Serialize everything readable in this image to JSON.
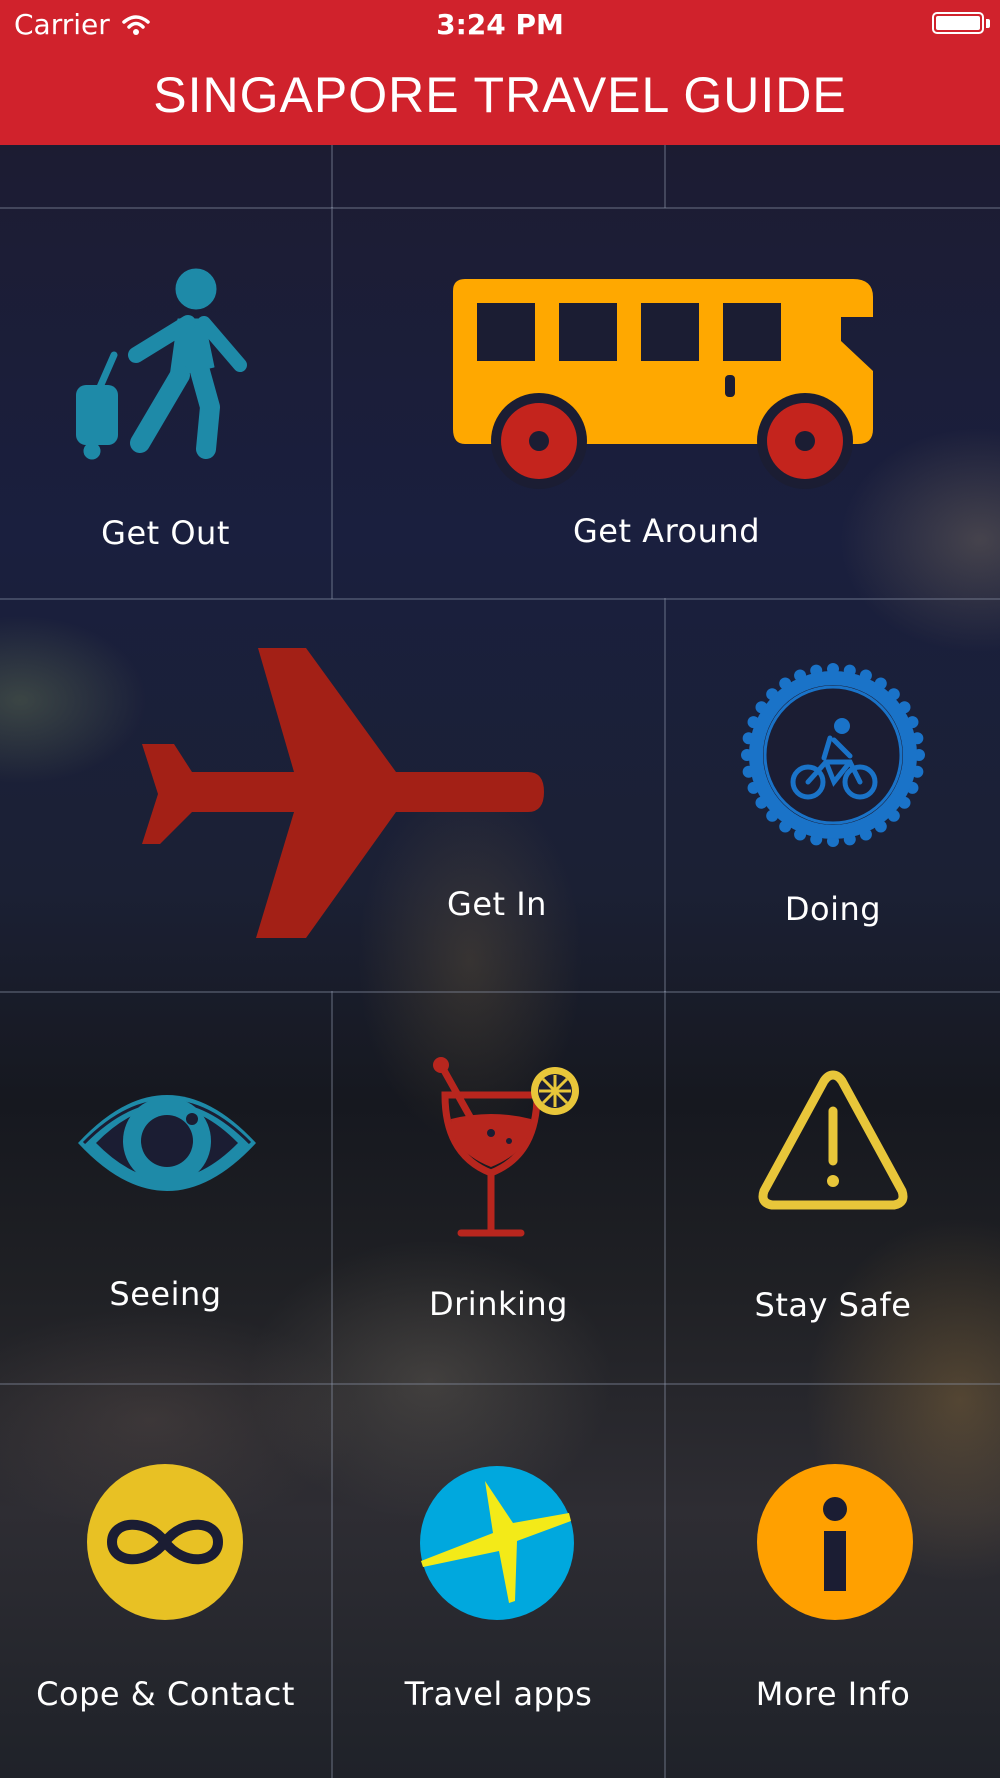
{
  "status_bar": {
    "carrier": "Carrier",
    "time": "3:24 PM"
  },
  "header": {
    "title": "SINGAPORE TRAVEL GUIDE"
  },
  "tiles": [
    {
      "label": "Get Out",
      "icon": "walking-traveler-icon",
      "color": "#1e8aa8"
    },
    {
      "label": "Get Around",
      "icon": "bus-icon",
      "color": "#ffa800"
    },
    {
      "label": "Get In",
      "icon": "airplane-icon",
      "color": "#a32016"
    },
    {
      "label": "Doing",
      "icon": "cycling-gear-icon",
      "color": "#1a73c8"
    },
    {
      "label": "Seeing",
      "icon": "eye-icon",
      "color": "#1e8aa8"
    },
    {
      "label": "Drinking",
      "icon": "cocktail-icon",
      "color": "#b8261e"
    },
    {
      "label": "Stay Safe",
      "icon": "warning-icon",
      "color": "#e8c63a"
    },
    {
      "label": "Cope & Contact",
      "icon": "infinity-icon",
      "color": "#e8c124"
    },
    {
      "label": "Travel apps",
      "icon": "plane-circle-icon",
      "color": "#00a8de"
    },
    {
      "label": "More Info",
      "icon": "info-icon",
      "color": "#ffa000"
    }
  ]
}
